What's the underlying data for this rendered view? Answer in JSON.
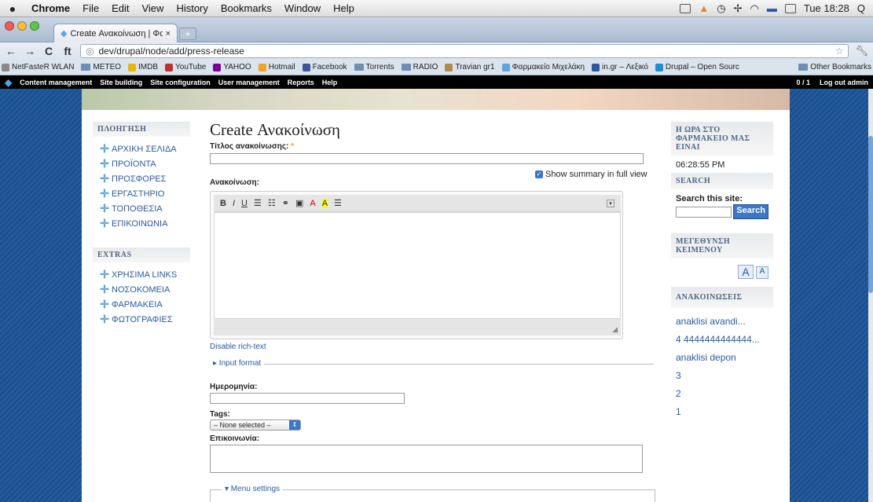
{
  "menubar": {
    "apple": "",
    "items": [
      "Chrome",
      "File",
      "Edit",
      "View",
      "History",
      "Bookmarks",
      "Window",
      "Help"
    ],
    "clock": "Tue 18:28"
  },
  "tab": {
    "title": "Create Ανακοίνωση | Φαρμα",
    "close": "×",
    "new_tab": "+"
  },
  "toolbar": {
    "back": "←",
    "forward": "→",
    "reload": "C",
    "home": "ft",
    "url": "dev/drupal/node/add/press-release"
  },
  "bookmarks": {
    "items": [
      "NetFasteR WLAN",
      "METEO",
      "IMDB",
      "YouTube",
      "YAHOO",
      "Hotmail",
      "Facebook",
      "Torrents",
      "RADIO",
      "Travian gr1",
      "Φαρμακείο Μιχελάκη",
      "in.gr – Λεξικό",
      "Drupal – Open Sourc"
    ],
    "other": "Other Bookmarks"
  },
  "admin": {
    "items": [
      "Content management",
      "Site building",
      "Site configuration",
      "User management",
      "Reports",
      "Help"
    ],
    "counter": "0 / 1",
    "logout": "Log out admin"
  },
  "nav": {
    "title": "ΠΛΟΗΓΗΣΗ",
    "items": [
      "ΑΡΧΙΚΗ ΣΕΛΙΔΑ",
      "ΠΡΟΪΟΝΤΑ",
      "ΠΡΟΣΦΟΡΕΣ",
      "ΕΡΓΑΣΤΗΡΙΟ",
      "ΤΟΠΟΘΕΣΙΑ",
      "ΕΠΙΚΟΙΝΩΝΙΑ"
    ]
  },
  "extras": {
    "title": "EXTRAS",
    "items": [
      "ΧΡΗΣΙΜΑ LINKS",
      "ΝΟΣΟΚΟΜΕΙΑ",
      "ΦΑΡΜΑΚΕΙΑ",
      "ΦΩΤΟΓΡΑΦΙΕΣ"
    ]
  },
  "form": {
    "page_title": "Create Ανακοίνωση",
    "title_label": "Τίτλος ανακοίνωσης:",
    "required": "*",
    "summary_check": "Show summary in full view",
    "body_label": "Ανακοίνωση:",
    "disable_rich": "Disable rich-text",
    "input_format": "▸ Input format",
    "date_label": "Ημερομηνία:",
    "tags_label": "Tags:",
    "tags_value": "– None selected –",
    "contact_label": "Επικοινωνία:",
    "menu_settings": "▾ Menu settings"
  },
  "right": {
    "clock_title": "Η ΩΡΑ ΣΤΟ ΦΑΡΜΑΚΕΙΟ ΜΑΣ ΕΙΝΑΙ",
    "clock_value": "06:28:55 PM",
    "search_title": "SEARCH",
    "search_label": "Search this site:",
    "search_button": "Search",
    "fontsize_title": "ΜΕΓΕΘΥΝΣΗ ΚΕΙΜΕΝΟΥ",
    "font_large": "A",
    "font_small": "A",
    "ann_title": "ΑΝΑΚΟΙΝΩΣΕΙΣ",
    "ann_items": [
      "anaklisi avandi...",
      "4 4444444444444...",
      "anaklisi depon",
      "3",
      "2",
      "1"
    ]
  }
}
